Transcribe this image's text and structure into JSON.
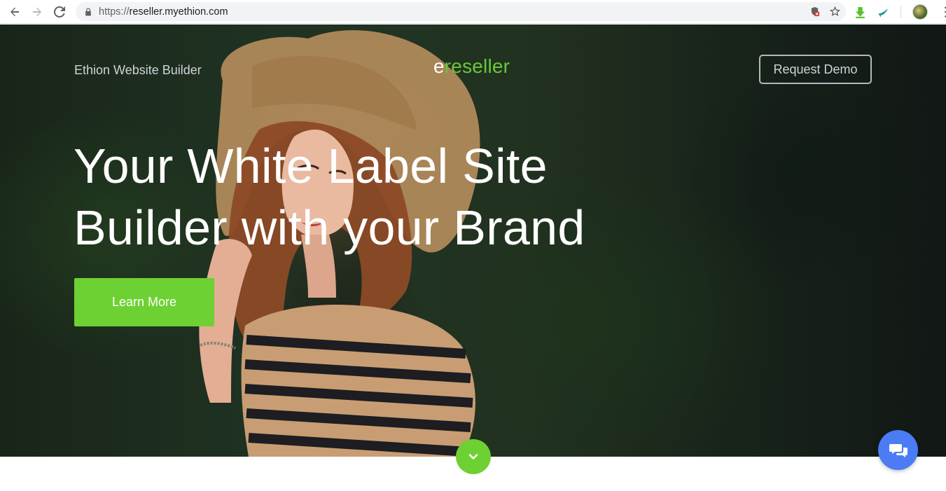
{
  "browser": {
    "url_scheme": "https://",
    "url_host": "reseller.myethion.com",
    "icons": [
      "back-icon",
      "forward-icon",
      "reload-icon",
      "lock-icon",
      "shield-blocked-icon",
      "star-icon",
      "download-extension-icon",
      "plane-extension-icon",
      "profile-avatar",
      "menu-icon"
    ]
  },
  "header": {
    "site_name": "Ethion Website Builder",
    "logo_prefix": "e",
    "logo_rest": "reseller",
    "demo_button": "Request Demo"
  },
  "hero": {
    "headline_line1": "Your White Label Site",
    "headline_line2": "Builder with your Brand",
    "cta_button": "Learn More"
  },
  "colors": {
    "accent_green": "#6dd133",
    "logo_green": "#67c838",
    "chat_blue": "#4b7cf3"
  }
}
